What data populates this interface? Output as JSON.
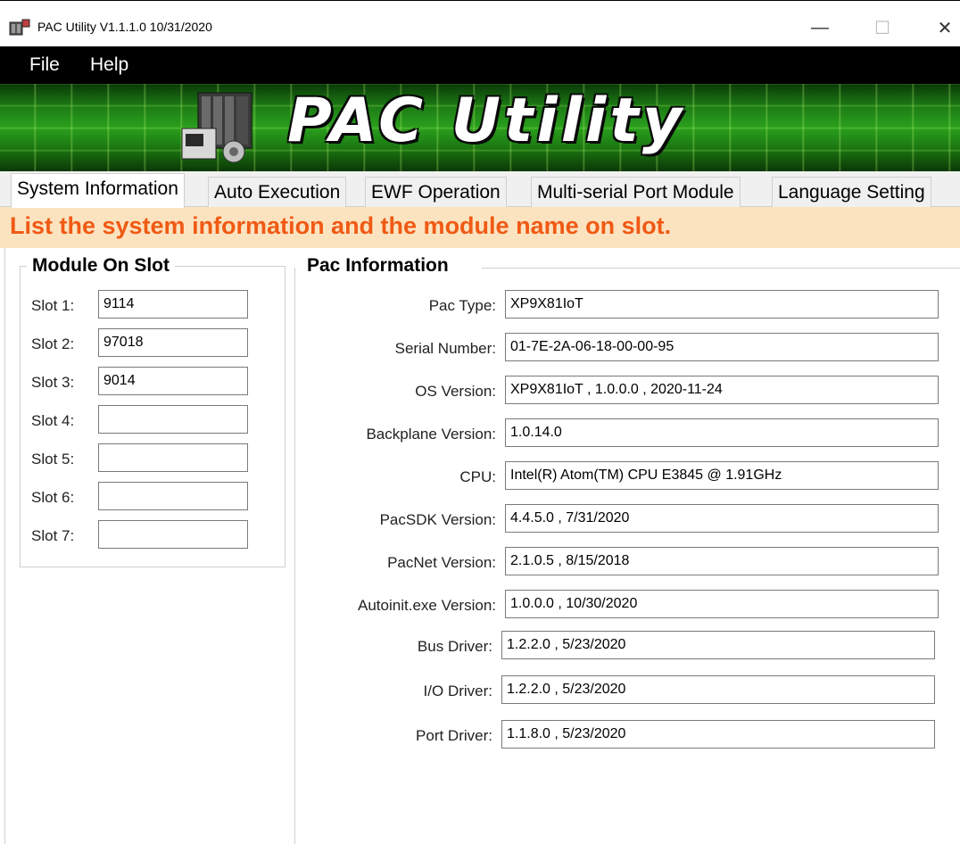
{
  "window": {
    "title": "PAC Utility V1.1.1.0  10/31/2020",
    "min_glyph": "—",
    "max_glyph": "☐",
    "close_glyph": "✕"
  },
  "menu": {
    "file": "File",
    "help": "Help"
  },
  "banner": {
    "title": "PAC Utility"
  },
  "tabs": [
    {
      "label": "System Information",
      "active": true
    },
    {
      "label": "Auto Execution",
      "active": false
    },
    {
      "label": "EWF Operation",
      "active": false
    },
    {
      "label": "Multi-serial Port Module",
      "active": false
    },
    {
      "label": "Language Setting",
      "active": false
    }
  ],
  "note": "List the system information and the module name on slot.",
  "module_on_slot": {
    "title": "Module On Slot",
    "slots": [
      {
        "label": "Slot 1:",
        "value": "9114"
      },
      {
        "label": "Slot 2:",
        "value": "97018"
      },
      {
        "label": "Slot 3:",
        "value": "9014"
      },
      {
        "label": "Slot 4:",
        "value": ""
      },
      {
        "label": "Slot 5:",
        "value": ""
      },
      {
        "label": "Slot 6:",
        "value": ""
      },
      {
        "label": "Slot 7:",
        "value": ""
      }
    ]
  },
  "pac_information": {
    "title": "Pac Information",
    "rows": [
      {
        "label": "Pac Type:",
        "value": "XP9X81IoT"
      },
      {
        "label": "Serial Number:",
        "value": "01-7E-2A-06-18-00-00-95"
      },
      {
        "label": "OS Version:",
        "value": "XP9X81IoT , 1.0.0.0 , 2020-11-24"
      },
      {
        "label": "Backplane Version:",
        "value": "1.0.14.0"
      },
      {
        "label": "CPU:",
        "value": "Intel(R) Atom(TM) CPU  E3845  @ 1.91GHz"
      },
      {
        "label": "PacSDK Version:",
        "value": "4.4.5.0 , 7/31/2020"
      },
      {
        "label": "PacNet Version:",
        "value": "2.1.0.5 , 8/15/2018"
      },
      {
        "label": "Autoinit.exe Version:",
        "value": "1.0.0.0 , 10/30/2020"
      },
      {
        "label": "Bus Driver:",
        "value": "1.2.2.0 , 5/23/2020"
      },
      {
        "label": "I/O Driver:",
        "value": "1.2.2.0 , 5/23/2020"
      },
      {
        "label": "Port Driver:",
        "value": "1.1.8.0 , 5/23/2020"
      }
    ]
  }
}
